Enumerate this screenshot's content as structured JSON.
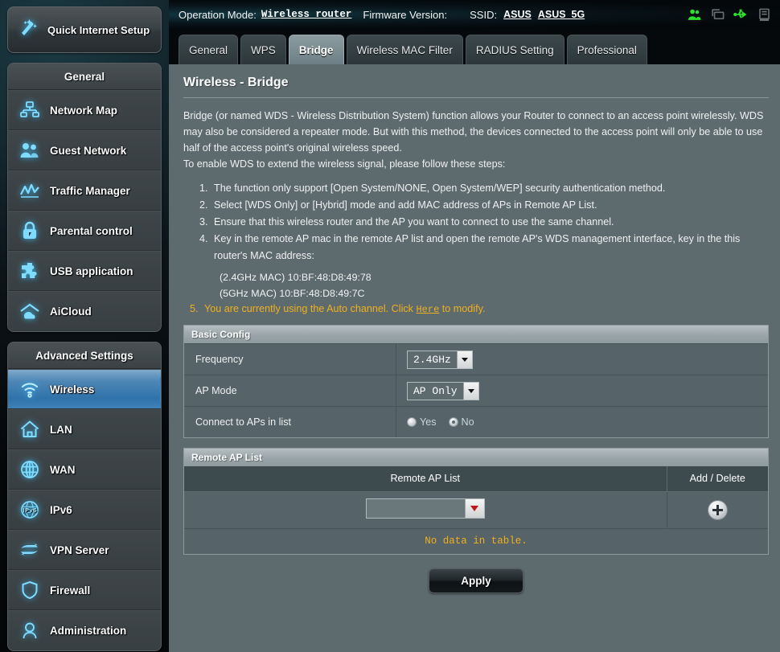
{
  "topbar": {
    "operation_mode_label": "Operation Mode:",
    "operation_mode_value": "Wireless router",
    "firmware_label": "Firmware Version:",
    "firmware_value": "",
    "ssid_label": "SSID:",
    "ssid_1": "ASUS",
    "ssid_2": "ASUS_5G",
    "icons": [
      {
        "name": "clients-icon",
        "color": "#2ee02e"
      },
      {
        "name": "devices-icon",
        "color": "#6b7073"
      },
      {
        "name": "usb-icon",
        "color": "#2ee02e"
      },
      {
        "name": "printer-icon",
        "color": "#6b7073"
      }
    ]
  },
  "sidebar": {
    "quick_setup": "Quick Internet Setup",
    "general_title": "General",
    "general_items": [
      {
        "label": "Network Map",
        "icon": "network-map-icon"
      },
      {
        "label": "Guest Network",
        "icon": "guest-network-icon"
      },
      {
        "label": "Traffic Manager",
        "icon": "traffic-manager-icon"
      },
      {
        "label": "Parental control",
        "icon": "parental-control-icon"
      },
      {
        "label": "USB application",
        "icon": "usb-application-icon"
      },
      {
        "label": "AiCloud",
        "icon": "aicloud-icon"
      }
    ],
    "advanced_title": "Advanced Settings",
    "advanced_items": [
      {
        "label": "Wireless",
        "icon": "wireless-icon",
        "active": true
      },
      {
        "label": "LAN",
        "icon": "lan-icon",
        "active": false
      },
      {
        "label": "WAN",
        "icon": "wan-icon",
        "active": false
      },
      {
        "label": "IPv6",
        "icon": "ipv6-icon",
        "active": false
      },
      {
        "label": "VPN Server",
        "icon": "vpn-server-icon",
        "active": false
      },
      {
        "label": "Firewall",
        "icon": "firewall-icon",
        "active": false
      },
      {
        "label": "Administration",
        "icon": "administration-icon",
        "active": false
      }
    ]
  },
  "tabs": [
    {
      "label": "General",
      "active": false
    },
    {
      "label": "WPS",
      "active": false
    },
    {
      "label": "Bridge",
      "active": true
    },
    {
      "label": "Wireless MAC Filter",
      "active": false
    },
    {
      "label": "RADIUS Setting",
      "active": false
    },
    {
      "label": "Professional",
      "active": false
    }
  ],
  "page": {
    "title": "Wireless - Bridge",
    "paragraph_1": "Bridge (or named WDS - Wireless Distribution System) function allows your Router to connect to an access point wirelessly. WDS may also be considered a repeater mode. But with this method, the devices connected to the access point will only be able to use half of the access point's original wireless speed.",
    "paragraph_2": "To enable WDS to extend the wireless signal, please follow these steps:",
    "steps": [
      "The function only support [Open System/NONE, Open System/WEP] security authentication method.",
      "Select [WDS Only] or [Hybrid] mode and add MAC address of APs in Remote AP List.",
      "Ensure that this wireless router and the AP you want to connect to use the same channel.",
      "Key in the remote AP mac in the remote AP list and open the remote AP's WDS management interface, key in the this router's MAC address:"
    ],
    "mac_24": "(2.4GHz MAC) 10:BF:48:D8:49:78",
    "mac_5": "(5GHz MAC) 10:BF:48:D8:49:7C",
    "note_number": "5.",
    "note_before_link": "You are currently using the Auto channel. Click",
    "note_link": "Here",
    "note_after_link": "to modify."
  },
  "basic_config": {
    "header": "Basic Config",
    "frequency_label": "Frequency",
    "frequency_value": "2.4GHz",
    "ap_mode_label": "AP Mode",
    "ap_mode_value": "AP Only",
    "connect_label": "Connect to APs in list",
    "connect_yes": "Yes",
    "connect_no": "No",
    "connect_selected": "No"
  },
  "remote_ap": {
    "header": "Remote AP List",
    "col_list": "Remote AP List",
    "col_action": "Add / Delete",
    "input_value": "",
    "add_icon": "plus-icon",
    "empty_text": "No data in table."
  },
  "footer": {
    "apply_label": "Apply"
  },
  "colors": {
    "content_bg": "#5d6b6f",
    "accent_blue": "#39b8f0",
    "warning_yellow": "#f0b01e",
    "active_nav": "#3f81b9"
  }
}
